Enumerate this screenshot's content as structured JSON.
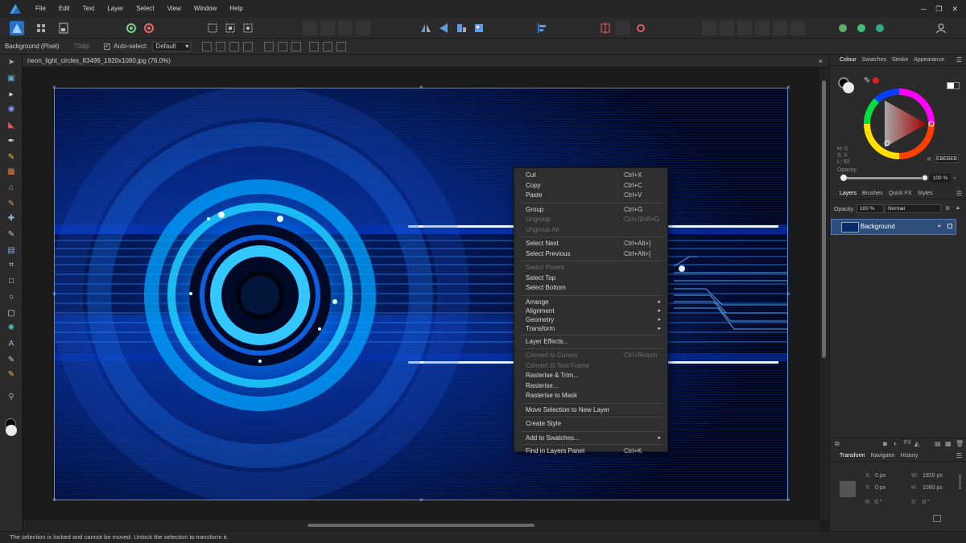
{
  "menubar": {
    "items": [
      "File",
      "Edit",
      "Text",
      "Layer",
      "Select",
      "View",
      "Window",
      "Help"
    ],
    "window_controls": [
      "─",
      "❐",
      "✕"
    ]
  },
  "context_toolbar": {
    "layer_name": "Background (Pixel)",
    "dpi": "72dpi",
    "auto_select_label": "Auto-select:",
    "auto_select_value": "Default"
  },
  "document": {
    "tab_title": "neon_light_circles_83499_1920x1080.jpg (76.0%)",
    "close": "×"
  },
  "context_menu": {
    "items": [
      {
        "label": "Cut",
        "shortcut": "Ctrl+X",
        "enabled": true
      },
      {
        "label": "Copy",
        "shortcut": "Ctrl+C",
        "enabled": true
      },
      {
        "label": "Paste",
        "shortcut": "Ctrl+V",
        "enabled": true
      },
      {
        "sep": true
      },
      {
        "label": "Group",
        "shortcut": "Ctrl+G",
        "enabled": true
      },
      {
        "label": "Ungroup",
        "shortcut": "Ctrl+Shift+G",
        "enabled": false
      },
      {
        "label": "Ungroup All",
        "shortcut": "",
        "enabled": false
      },
      {
        "sep": true
      },
      {
        "label": "Select Next",
        "shortcut": "Ctrl+Alt+]",
        "enabled": true
      },
      {
        "label": "Select Previous",
        "shortcut": "Ctrl+Alt+[",
        "enabled": true
      },
      {
        "sep": true
      },
      {
        "label": "Select Parent",
        "shortcut": "",
        "enabled": false
      },
      {
        "label": "Select Top",
        "shortcut": "",
        "enabled": true
      },
      {
        "label": "Select Bottom",
        "shortcut": "",
        "enabled": true
      },
      {
        "sep": true
      },
      {
        "label": "Arrange",
        "shortcut": "",
        "enabled": true,
        "submenu": true
      },
      {
        "label": "Alignment",
        "shortcut": "",
        "enabled": true,
        "submenu": true
      },
      {
        "label": "Geometry",
        "shortcut": "",
        "enabled": true,
        "submenu": true
      },
      {
        "label": "Transform",
        "shortcut": "",
        "enabled": true,
        "submenu": true
      },
      {
        "sep": true
      },
      {
        "label": "Layer Effects...",
        "shortcut": "",
        "enabled": true
      },
      {
        "sep": true
      },
      {
        "label": "Convert to Curves",
        "shortcut": "Ctrl+Return",
        "enabled": false
      },
      {
        "label": "Convert to Text Frame",
        "shortcut": "",
        "enabled": false
      },
      {
        "label": "Rasterise & Trim...",
        "shortcut": "",
        "enabled": true
      },
      {
        "label": "Rasterise...",
        "shortcut": "",
        "enabled": true
      },
      {
        "label": "Rasterise to Mask",
        "shortcut": "",
        "enabled": true
      },
      {
        "sep": true
      },
      {
        "label": "Move Selection to New Layer",
        "shortcut": "",
        "enabled": true
      },
      {
        "sep": true
      },
      {
        "label": "Create Style",
        "shortcut": "",
        "enabled": true
      },
      {
        "sep": true
      },
      {
        "label": "Add to Swatches...",
        "shortcut": "",
        "enabled": true,
        "submenu": true
      },
      {
        "sep": true
      },
      {
        "label": "Find in Layers Panel",
        "shortcut": "Ctrl+K",
        "enabled": true
      }
    ]
  },
  "colour_panel": {
    "tabs": [
      "Colour",
      "Swatches",
      "Stroke",
      "Appearance"
    ],
    "h": "H: 0",
    "s": "S: 0",
    "l": "L: 92",
    "hex": "EBEBEB",
    "hex_prefix": "#:",
    "opacity_label": "Opacity",
    "opacity_value": "100 %"
  },
  "layers_panel": {
    "tabs": [
      "Layers",
      "Brushes",
      "Quick FX",
      "Styles"
    ],
    "opacity_label": "Opacity:",
    "opacity_value": "100 %",
    "blend_mode": "Normal",
    "layers": [
      "Background"
    ]
  },
  "transform_panel": {
    "tabs": [
      "Transform",
      "Navigator",
      "History"
    ],
    "x_label": "X:",
    "x": "0 px",
    "y_label": "Y:",
    "y": "0 px",
    "w_label": "W:",
    "w": "1920 px",
    "h_label": "H:",
    "h": "1080 px",
    "r_label": "R:",
    "r": "0 °",
    "s_label": "S:",
    "s": "0 °"
  },
  "status": {
    "message": "The selection is locked and cannot be moved. Unlock the selection to transform it."
  }
}
